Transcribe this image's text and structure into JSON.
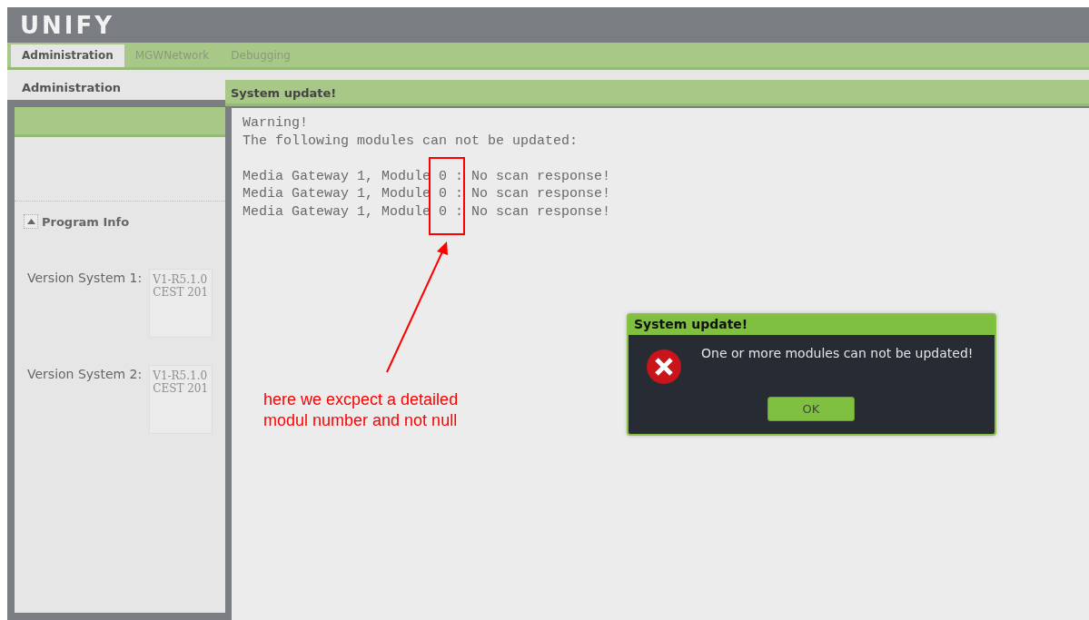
{
  "header": {
    "logo": "UNIFY"
  },
  "tabs": [
    {
      "label": "Administration",
      "selected": true
    },
    {
      "label": "MGWNetwork",
      "selected": false
    },
    {
      "label": "Debugging",
      "selected": false
    }
  ],
  "sidebar": {
    "title": "Administration",
    "section": {
      "title": "Program Info",
      "expanded": true
    },
    "fields": [
      {
        "label": "Version System 1:",
        "lines": [
          "V1-R5.1.0",
          "CEST 201"
        ]
      },
      {
        "label": "Version System 2:",
        "lines": [
          "V1-R5.1.0",
          "CEST 201"
        ]
      }
    ]
  },
  "dialog": {
    "title": "System update!",
    "lines": [
      "Warning!",
      "The following modules can not be updated:"
    ],
    "module_lines": [
      "Media Gateway 1, Module 0 : No scan response!",
      "Media Gateway 1, Module 0 : No scan response!",
      "Media Gateway 1, Module 0 : No scan response!"
    ]
  },
  "alert": {
    "title": "System update!",
    "message": "One or more modules can not be updated!",
    "button": "OK"
  },
  "annotation": {
    "text": "here we excpect a detailed modul number and not null"
  }
}
